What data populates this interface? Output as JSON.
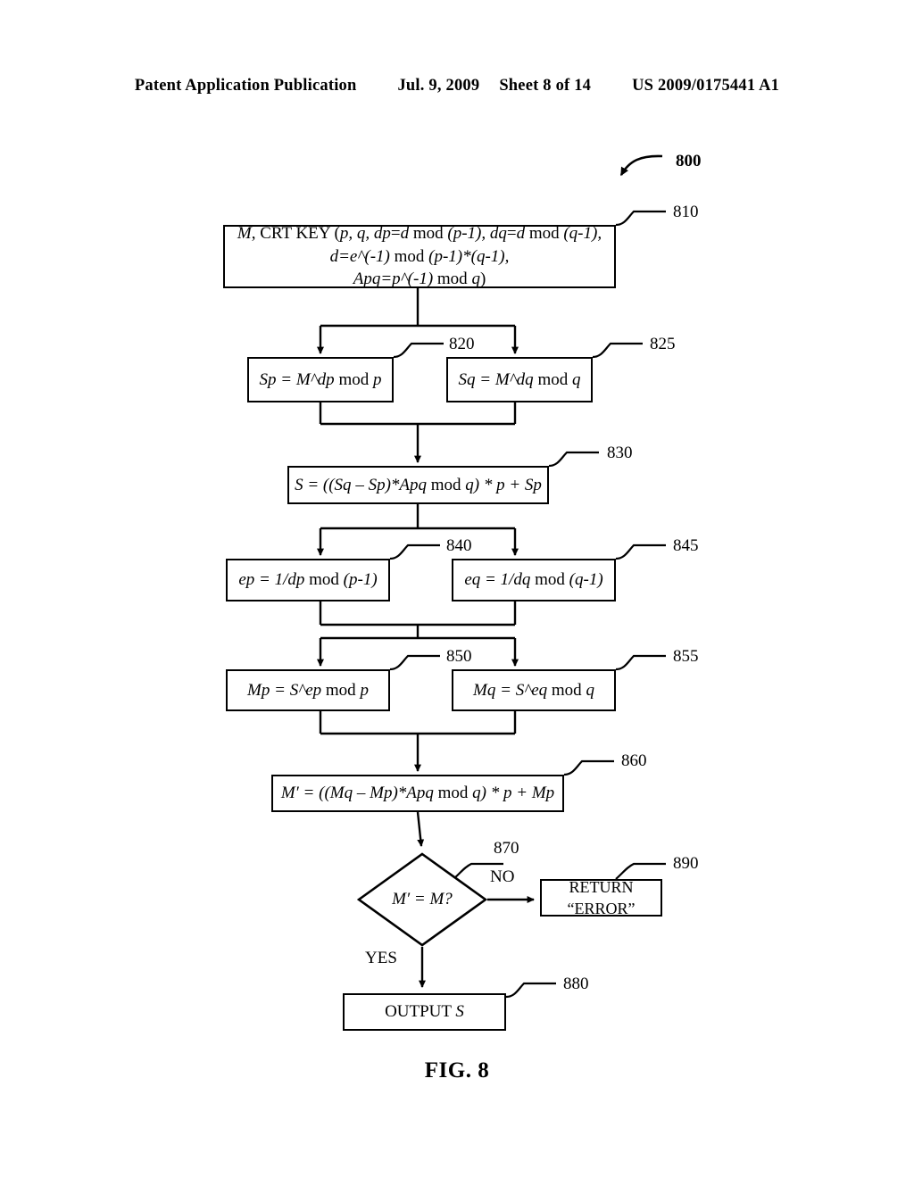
{
  "header": {
    "publication": "Patent Application Publication",
    "date": "Jul. 9, 2009",
    "sheet": "Sheet 8 of 14",
    "doc_number": "US 2009/0175441 A1"
  },
  "figure": {
    "caption": "FIG. 8",
    "diagram_ref": "800"
  },
  "nodes": {
    "n810": {
      "ref": "810",
      "line1_a": "M",
      "line1_b": ", CRT KEY (",
      "line1_c": "p, q, dp",
      "line1_d": "=",
      "line1_e": "d",
      "line1_f": " mod ",
      "line1_g": "(p-1),",
      "line1_h": "  dq",
      "line1_i": "=",
      "line1_j": "d",
      "line1_k": " mod ",
      "line1_l": "(q-1),",
      "line2_a": "d=e^(-1)",
      "line2_b": " mod ",
      "line2_c": "(p-1)*(q-1),",
      "line3_a": "Apq=p^(-1)",
      "line3_b": " mod ",
      "line3_c": "q",
      "line3_d": ")"
    },
    "n820": {
      "ref": "820",
      "text_a": "Sp = M^dp",
      "text_b": " mod ",
      "text_c": "p"
    },
    "n825": {
      "ref": "825",
      "text_a": "Sq = M^dq",
      "text_b": " mod ",
      "text_c": "q"
    },
    "n830": {
      "ref": "830",
      "text_a": "S = ((Sq ",
      "text_b": "–",
      "text_c": " Sp)*Apq",
      "text_d": " mod ",
      "text_e": "q) * p + Sp"
    },
    "n840": {
      "ref": "840",
      "text_a": "ep = 1/dp",
      "text_b": " mod ",
      "text_c": "(p-1)"
    },
    "n845": {
      "ref": "845",
      "text_a": "eq = 1/dq",
      "text_b": " mod ",
      "text_c": "(q-1)"
    },
    "n850": {
      "ref": "850",
      "text_a": "Mp = S^ep",
      "text_b": " mod ",
      "text_c": "p"
    },
    "n855": {
      "ref": "855",
      "text_a": "Mq = S^eq",
      "text_b": " mod ",
      "text_c": "q"
    },
    "n860": {
      "ref": "860",
      "text_a": "M′ = ((Mq ",
      "text_b": "–",
      "text_c": " Mp)*Apq",
      "text_d": " mod ",
      "text_e": "q) * p + Mp"
    },
    "n870": {
      "ref": "870",
      "text": "M′ = M?"
    },
    "n880": {
      "ref": "880",
      "text_a": "OUTPUT ",
      "text_b": "S"
    },
    "n890": {
      "ref": "890",
      "line1": "RETURN",
      "line2": "“ERROR”"
    }
  },
  "edges": {
    "no_label": "NO",
    "yes_label": "YES"
  },
  "style": {
    "line_color": "#000000",
    "background": "#ffffff"
  }
}
